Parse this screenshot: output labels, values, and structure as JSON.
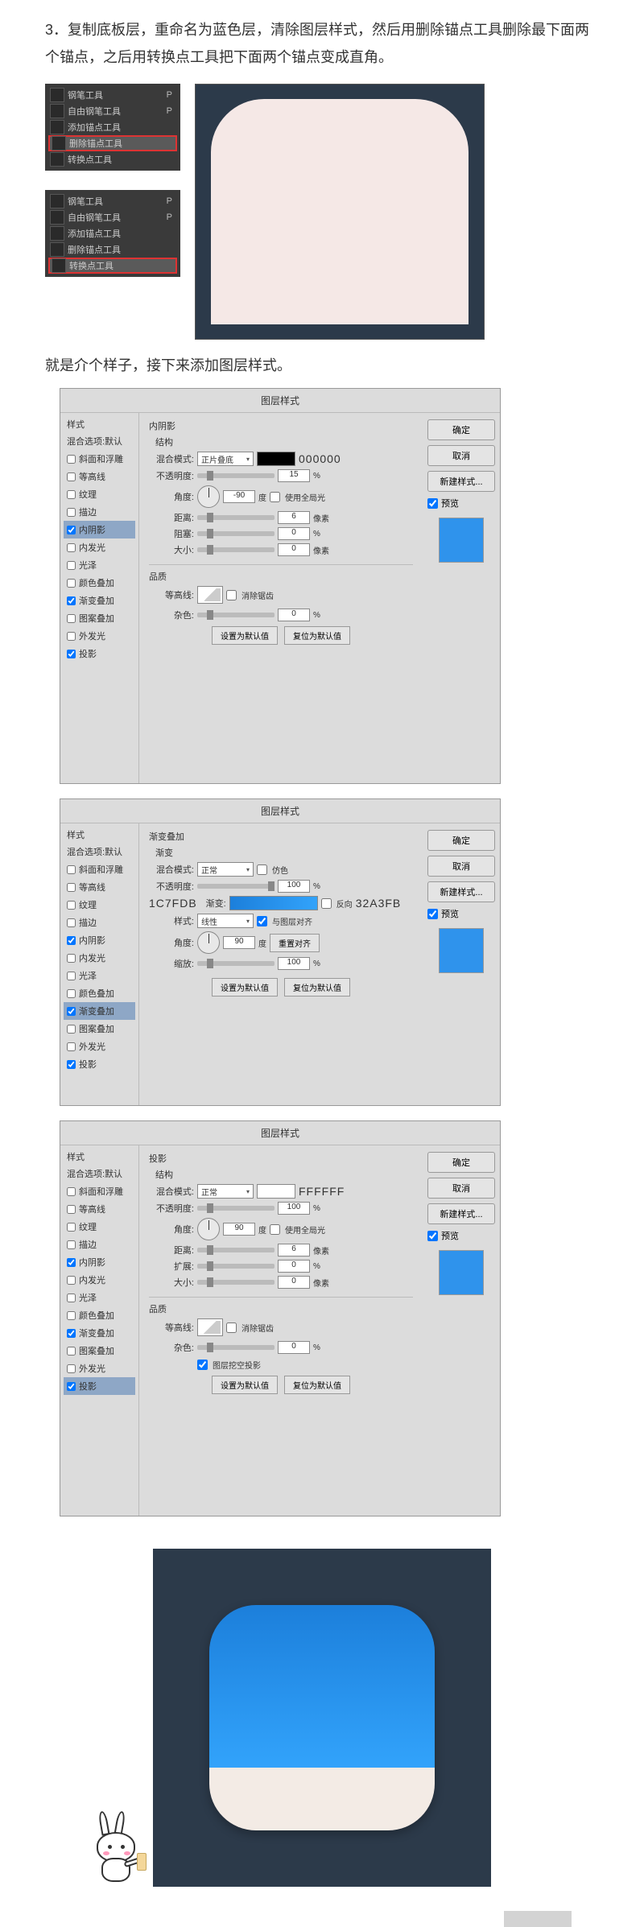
{
  "intro_step": "3",
  "intro_text": "复制底板层，重命名为蓝色层，清除图层样式，然后用删除锚点工具删除最下面两个锚点，之后用转换点工具把下面两个锚点变成直角。",
  "tools": {
    "panel_a": [
      {
        "label": "钢笔工具",
        "short": "P"
      },
      {
        "label": "自由钢笔工具",
        "short": "P"
      },
      {
        "label": "添加锚点工具",
        "short": ""
      },
      {
        "label": "删除锚点工具",
        "sel": true
      },
      {
        "label": "转换点工具",
        "short": ""
      }
    ],
    "panel_b": [
      {
        "label": "钢笔工具",
        "short": "P"
      },
      {
        "label": "自由钢笔工具",
        "short": "P"
      },
      {
        "label": "添加锚点工具",
        "short": ""
      },
      {
        "label": "删除锚点工具",
        "short": ""
      },
      {
        "label": "转换点工具",
        "sel": true
      }
    ]
  },
  "subtext": "就是介个样子，接下来添加图层样式。",
  "dlg_title": "图层样式",
  "styles_header": "样式",
  "styles_sub": "混合选项:默认",
  "style_items": [
    "斜面和浮雕",
    "等高线",
    "纹理",
    "描边",
    "内阴影",
    "内发光",
    "光泽",
    "颜色叠加",
    "渐变叠加",
    "图案叠加",
    "外发光",
    "投影"
  ],
  "right": {
    "ok": "确定",
    "cancel": "取消",
    "newstyle": "新建样式...",
    "preview": "预览"
  },
  "buttons": {
    "make_default": "设置为默认值",
    "reset_default": "复位为默认值",
    "reset_align": "重置对齐"
  },
  "inner_shadow": {
    "title": "内阴影",
    "struct": "结构",
    "blend": "混合模式:",
    "blend_val": "正片叠底",
    "color_hex": "000000",
    "opacity": "不透明度:",
    "opacity_val": "15",
    "pct": "%",
    "angle": "角度:",
    "angle_val": "-90",
    "deg": "度",
    "global": "使用全局光",
    "distance": "距离:",
    "distance_val": "6",
    "px": "像素",
    "choke": "阻塞:",
    "choke_val": "0",
    "size": "大小:",
    "size_val": "0",
    "quality": "品质",
    "contour": "等高线:",
    "anti": "消除锯齿",
    "noise": "杂色:",
    "noise_val": "0"
  },
  "gradient": {
    "title": "渐变叠加",
    "sub": "渐变",
    "blend": "混合模式:",
    "blend_val": "正常",
    "dither": "仿色",
    "opacity": "不透明度:",
    "opacity_val": "100",
    "pct": "%",
    "left_color": "1C7FDB",
    "right_color": "32A3FB",
    "grad": "渐变:",
    "reverse": "反向",
    "style": "样式:",
    "style_val": "线性",
    "align": "与图层对齐",
    "angle": "角度:",
    "angle_val": "90",
    "deg": "度",
    "scale": "缩放:",
    "scale_val": "100"
  },
  "drop_shadow": {
    "title": "投影",
    "struct": "结构",
    "blend": "混合模式:",
    "blend_val": "正常",
    "color_hex": "FFFFFF",
    "opacity": "不透明度:",
    "opacity_val": "100",
    "pct": "%",
    "angle": "角度:",
    "angle_val": "90",
    "deg": "度",
    "global": "使用全局光",
    "distance": "距离:",
    "distance_val": "6",
    "px": "像素",
    "spread": "扩展:",
    "spread_val": "0",
    "size": "大小:",
    "size_val": "0",
    "quality": "品质",
    "contour": "等高线:",
    "anti": "消除锯齿",
    "noise": "杂色:",
    "noise_val": "0",
    "knockout": "图层挖空投影"
  }
}
